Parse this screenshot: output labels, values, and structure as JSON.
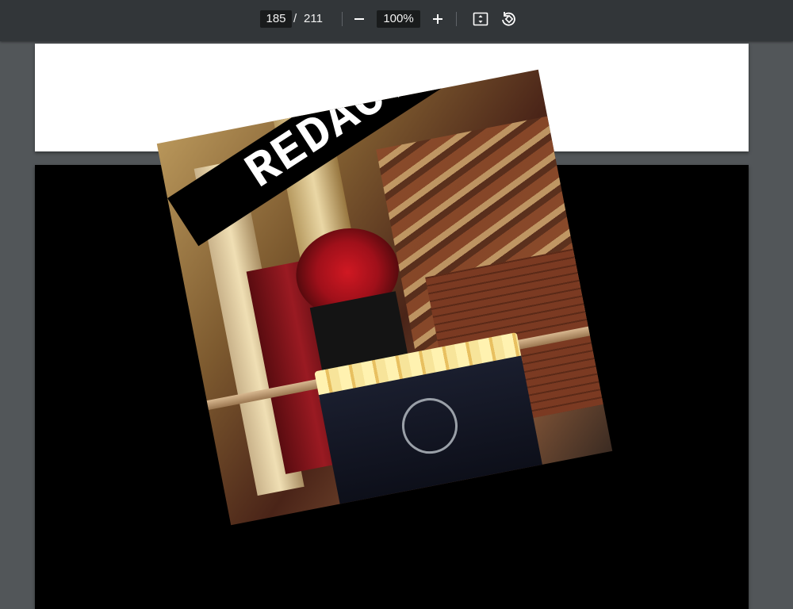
{
  "toolbar": {
    "current_page": "185",
    "separator": "/",
    "total_pages": "211",
    "zoom": "100%",
    "zoom_out_icon": "minus-icon",
    "zoom_in_icon": "plus-icon",
    "fit_icon": "fit-to-page-icon",
    "rotate_icon": "rotate-icon"
  },
  "document": {
    "image_overlay_text": "REDACTED"
  }
}
